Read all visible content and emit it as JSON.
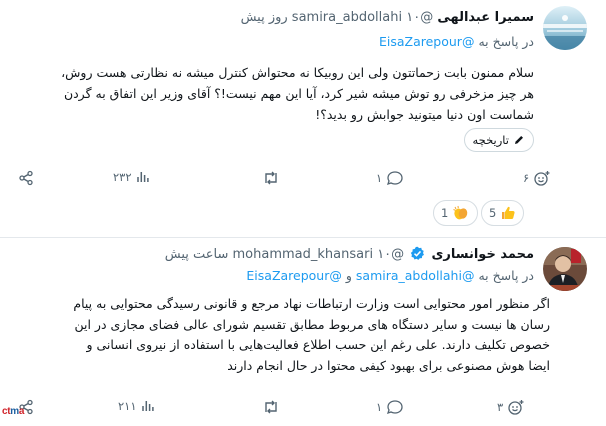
{
  "tweets": [
    {
      "display_name": "سمیرا عبدالهی",
      "handle": "@samira_abdollahi",
      "time_ago": "۱۰ روز پیش",
      "reply_prefix": "در پاسخ به",
      "reply_mentions": [
        "@EisaZarepour"
      ],
      "body": "سلام ممنون بابت زحماتتون ولی این روبیکا نه محتواش کنترل میشه نه نظارتی هست روش،\nهر چیز مزخرفی رو توش میشه شیر کرد، آیا این مهم نیست!؟ آقای وزیر این اتفاق به گردن\nشماست اون دنیا میتونید جوابش رو بدید؟!",
      "history_label": "تاریخچه",
      "actions": {
        "views": "۲۳۲",
        "retweets": "",
        "likes": "۱",
        "emoji": "۶"
      },
      "reactions": [
        {
          "emoji_name": "thumbs-up-emoji",
          "count": "5"
        },
        {
          "emoji_name": "clapping-hands-emoji",
          "count": "1"
        }
      ]
    },
    {
      "display_name": "محمد خوانساری",
      "verified": true,
      "handle": "@mohammad_khansari",
      "time_ago": "۱۰ ساعت پیش",
      "reply_prefix": "در پاسخ به",
      "reply_mentions": [
        "@samira_abdollahi",
        "@EisaZarepour"
      ],
      "reply_joiner": "و",
      "body": "اگر منظور امور محتوایی است وزارت ارتباطات نهاد مرجع و قانونی رسیدگی محتوایی به پیام\nرسان ها نیست و سایر دستگاه های مربوط مطابق تقسیم شورای عالی فضای مجازی  در این\nخصوص تکلیف دارند. علی رغم این حسب اطلاع فعالیت‌هایی با استفاده از نیروی انسانی و\nایضا هوش مصنوعی برای بهبود کیفی محتوا در حال انجام دارند",
      "actions": {
        "views": "۲۱۱",
        "retweets": "",
        "likes": "۱",
        "emoji": "۳"
      }
    }
  ],
  "watermark": {
    "part1": "ct",
    "part2": "m",
    "part3": "a"
  },
  "colors": {
    "link": "#1d9bf0",
    "secondary_text": "#536471",
    "verified": "#1d9bf0",
    "divider": "#e4e8ec"
  }
}
